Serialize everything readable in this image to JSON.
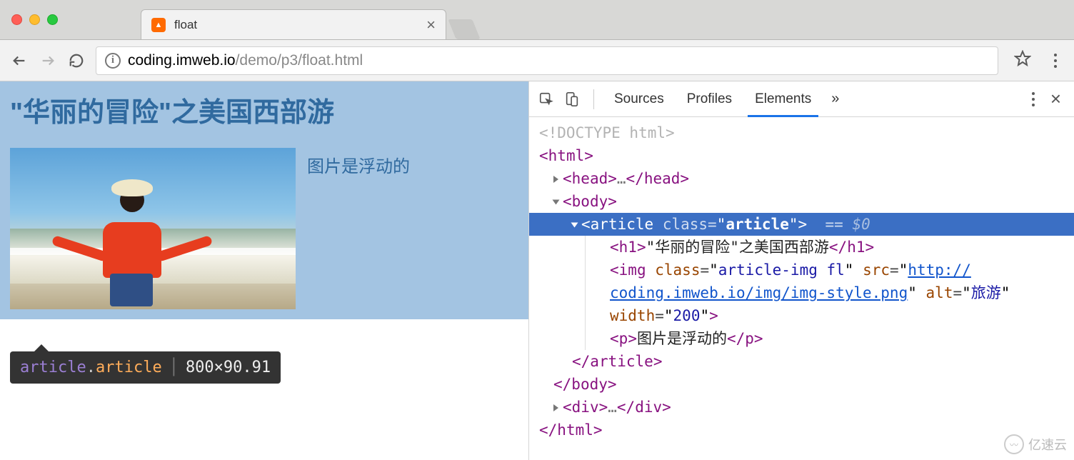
{
  "browser": {
    "tab_title": "float",
    "url_domain": "coding.imweb.io",
    "url_path": "/demo/p3/float.html"
  },
  "page": {
    "h1": "\"华丽的冒险\"之美国西部游",
    "p": "图片是浮动的"
  },
  "tooltip": {
    "tag": "article",
    "cls": "article",
    "dim": "800×90.91"
  },
  "devtools": {
    "tabs": {
      "sources": "Sources",
      "profiles": "Profiles",
      "elements": "Elements"
    },
    "dom": {
      "doctype": "<!DOCTYPE html>",
      "html_open": "html",
      "head": "head",
      "body": "body",
      "article_tag": "article",
      "article_class_attr": "class",
      "article_class_val": "article",
      "selected_suffix": "== $0",
      "h1_tag": "h1",
      "h1_text": "\"华丽的冒险\"之美国西部游",
      "img_tag": "img",
      "img_class_attr": "class",
      "img_class_val": "article-img fl",
      "img_src_attr": "src",
      "img_src_val1": "http://",
      "img_src_val2": "coding.imweb.io/img/img-style.png",
      "img_alt_attr": "alt",
      "img_alt_val": "旅游",
      "img_width_attr": "width",
      "img_width_val": "200",
      "p_tag": "p",
      "p_text": "图片是浮动的",
      "article_close": "article",
      "body_close": "body",
      "div_tag": "div",
      "html_close": "html"
    }
  },
  "watermark": "亿速云"
}
